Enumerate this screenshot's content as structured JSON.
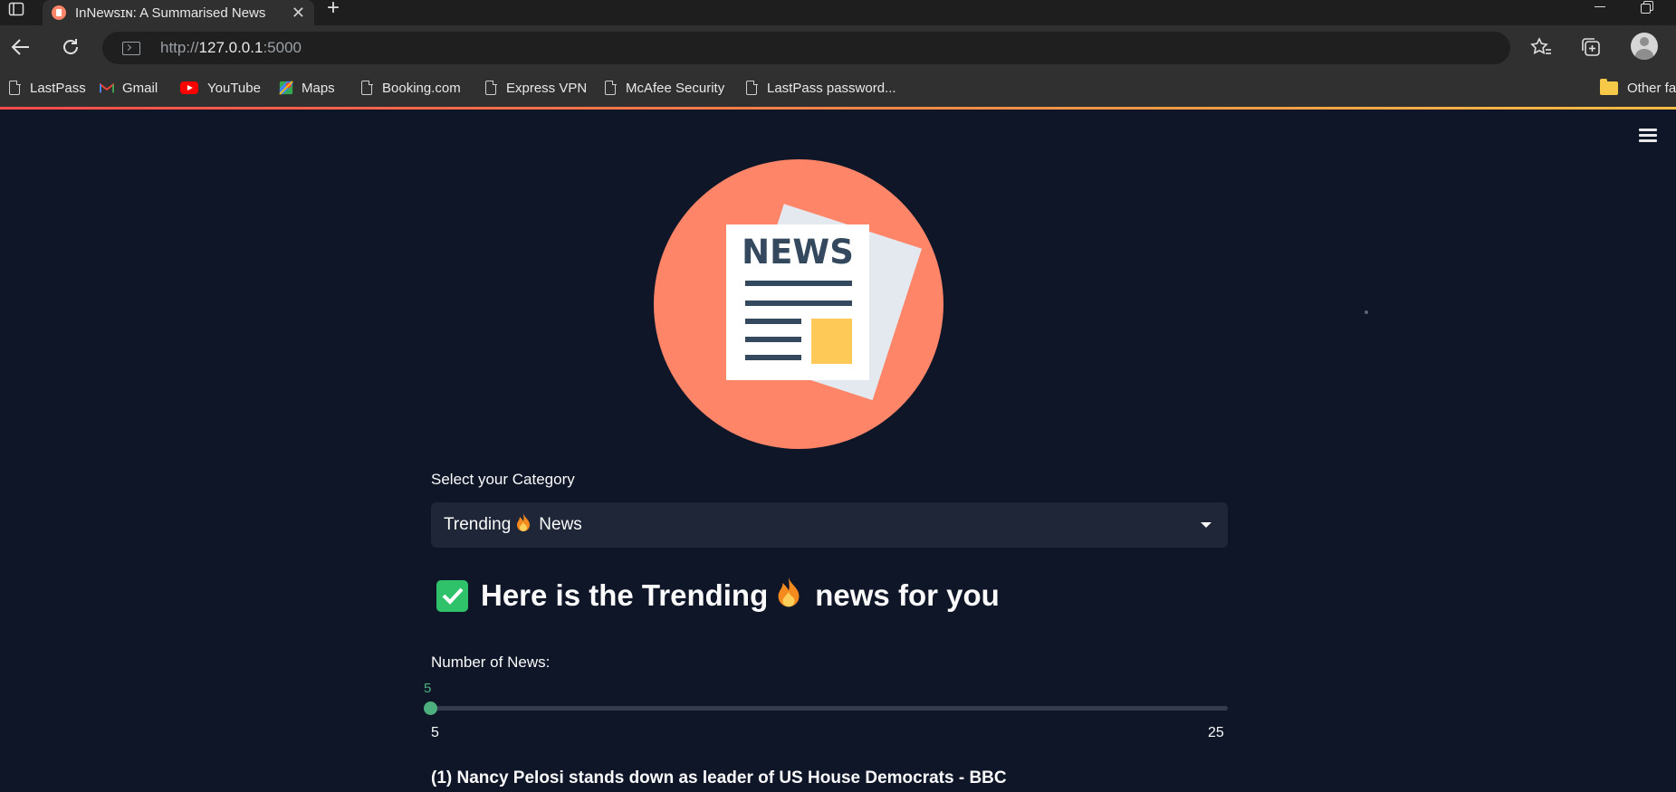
{
  "browser": {
    "tab": {
      "title": "InNewsɪɴ: A Summarised News"
    },
    "url": {
      "prefix": "http://",
      "host": "127.0.0.1",
      "port": ":5000"
    },
    "bookmarks": [
      {
        "label": "LastPass",
        "icon": "page-icon"
      },
      {
        "label": "Gmail",
        "icon": "gmail-icon"
      },
      {
        "label": "YouTube",
        "icon": "youtube-icon"
      },
      {
        "label": "Maps",
        "icon": "maps-icon"
      },
      {
        "label": "Booking.com",
        "icon": "page-icon"
      },
      {
        "label": "Express VPN",
        "icon": "page-icon"
      },
      {
        "label": "McAfee Security",
        "icon": "page-icon"
      },
      {
        "label": "LastPass password...",
        "icon": "page-icon"
      }
    ],
    "other_favorites": "Other fa",
    "accent_colors": {
      "load_start": "#ff4b4b",
      "load_end": "#ffbd45"
    }
  },
  "app": {
    "logo": {
      "text": "NEWS",
      "circle_color": "#ff8569"
    },
    "category": {
      "label": "Select your Category",
      "selected_prefix": "Trending",
      "selected_suffix": "News"
    },
    "heading": {
      "prefix": "Here is the Trending",
      "suffix": "news for you"
    },
    "slider": {
      "label": "Number of News:",
      "value": "5",
      "min": "5",
      "max": "25",
      "fraction": 0
    },
    "news": [
      {
        "title": "(1) Nancy Pelosi stands down as leader of US House Democrats - BBC"
      }
    ],
    "colors": {
      "background": "#0e1628",
      "select_bg": "#1e2638",
      "slider": "#4caf7d",
      "check": "#2fc26b"
    }
  }
}
